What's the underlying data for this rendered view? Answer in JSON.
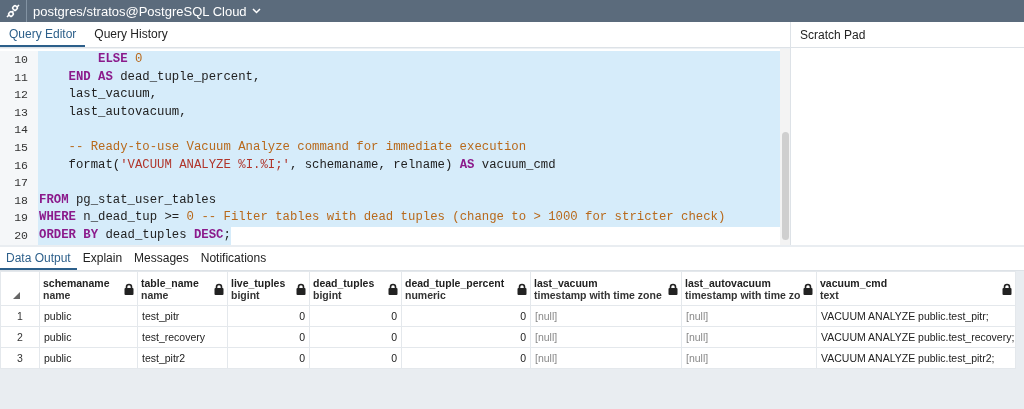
{
  "connection": {
    "title": "postgres/stratos@PostgreSQL Cloud"
  },
  "editor_tabs": [
    {
      "label": "Query Editor",
      "selected": true
    },
    {
      "label": "Query History",
      "selected": false
    }
  ],
  "scratch_pad": {
    "title": "Scratch Pad"
  },
  "editor": {
    "lines": [
      {
        "number": "10",
        "tokens": [
          {
            "kind": "keyword",
            "text": "        ELSE"
          },
          {
            "kind": "number",
            "text": " 0"
          }
        ]
      },
      {
        "number": "11",
        "tokens": [
          {
            "kind": "keyword",
            "text": "    END AS"
          },
          {
            "kind": "plain",
            "text": " dead_tuple_percent,"
          }
        ]
      },
      {
        "number": "12",
        "tokens": [
          {
            "kind": "plain",
            "text": "    last_vacuum,"
          }
        ]
      },
      {
        "number": "13",
        "tokens": [
          {
            "kind": "plain",
            "text": "    last_autovacuum,"
          }
        ]
      },
      {
        "number": "14"
      },
      {
        "number": "15",
        "tokens": [
          {
            "kind": "comment",
            "text": "    -- Ready-to-use Vacuum Analyze command for immediate execution"
          }
        ]
      },
      {
        "number": "16",
        "tokens": [
          {
            "kind": "plain",
            "text": "    format("
          },
          {
            "kind": "string",
            "text": "'VACUUM ANALYZE %I.%I;'"
          },
          {
            "kind": "plain",
            "text": ", schemaname, relname) "
          },
          {
            "kind": "keyword",
            "text": "AS"
          },
          {
            "kind": "plain",
            "text": " vacuum_cmd"
          }
        ]
      },
      {
        "number": "17"
      },
      {
        "number": "18",
        "tokens": [
          {
            "kind": "keyword",
            "text": "FROM"
          },
          {
            "kind": "plain",
            "text": " pg_stat_user_tables"
          }
        ]
      },
      {
        "number": "19",
        "tokens": [
          {
            "kind": "keyword",
            "text": "WHERE"
          },
          {
            "kind": "plain",
            "text": " n_dead_tup >= "
          },
          {
            "kind": "number",
            "text": "0"
          },
          {
            "kind": "comment",
            "text": " -- Filter tables with dead tuples (change to > 1000 for stricter check)"
          }
        ]
      },
      {
        "number": "20",
        "tokens": [
          {
            "kind": "keyword",
            "text": "ORDER BY"
          },
          {
            "kind": "plain",
            "text": " dead_tuples "
          },
          {
            "kind": "keyword",
            "text": "DESC"
          },
          {
            "kind": "plain",
            "text": ";"
          }
        ]
      }
    ]
  },
  "output_tabs": [
    {
      "label": "Data Output",
      "selected": true
    },
    {
      "label": "Explain",
      "selected": false
    },
    {
      "label": "Messages",
      "selected": false
    },
    {
      "label": "Notifications",
      "selected": false
    }
  ],
  "table": {
    "columns": [
      {
        "name": "schemaname",
        "type": "name",
        "kind": "text"
      },
      {
        "name": "table_name",
        "type": "name",
        "kind": "text"
      },
      {
        "name": "live_tuples",
        "type": "bigint",
        "kind": "number"
      },
      {
        "name": "dead_tuples",
        "type": "bigint",
        "kind": "number"
      },
      {
        "name": "dead_tuple_percent",
        "type": "numeric",
        "kind": "number"
      },
      {
        "name": "last_vacuum",
        "type": "timestamp with time zone",
        "kind": "text"
      },
      {
        "name": "last_autovacuum",
        "type": "timestamp with time zo",
        "kind": "text"
      },
      {
        "name": "vacuum_cmd",
        "type": "text",
        "kind": "text"
      }
    ],
    "rows": [
      {
        "number": "1",
        "cells": [
          {
            "text": "public",
            "null": false
          },
          {
            "text": "test_pitr",
            "null": false
          },
          {
            "text": "0",
            "null": false
          },
          {
            "text": "0",
            "null": false
          },
          {
            "text": "0",
            "null": false
          },
          {
            "text": "[null]",
            "null": true
          },
          {
            "text": "[null]",
            "null": true
          },
          {
            "text": "VACUUM ANALYZE public.test_pitr;",
            "null": false
          }
        ]
      },
      {
        "number": "2",
        "cells": [
          {
            "text": "public",
            "null": false
          },
          {
            "text": "test_recovery",
            "null": false
          },
          {
            "text": "0",
            "null": false
          },
          {
            "text": "0",
            "null": false
          },
          {
            "text": "0",
            "null": false
          },
          {
            "text": "[null]",
            "null": true
          },
          {
            "text": "[null]",
            "null": true
          },
          {
            "text": "VACUUM ANALYZE public.test_recovery;",
            "null": false
          }
        ]
      },
      {
        "number": "3",
        "cells": [
          {
            "text": "public",
            "null": false
          },
          {
            "text": "test_pitr2",
            "null": false
          },
          {
            "text": "0",
            "null": false
          },
          {
            "text": "0",
            "null": false
          },
          {
            "text": "0",
            "null": false
          },
          {
            "text": "[null]",
            "null": true
          },
          {
            "text": "[null]",
            "null": true
          },
          {
            "text": "VACUUM ANALYZE public.test_pitr2;",
            "null": false
          }
        ]
      }
    ]
  }
}
